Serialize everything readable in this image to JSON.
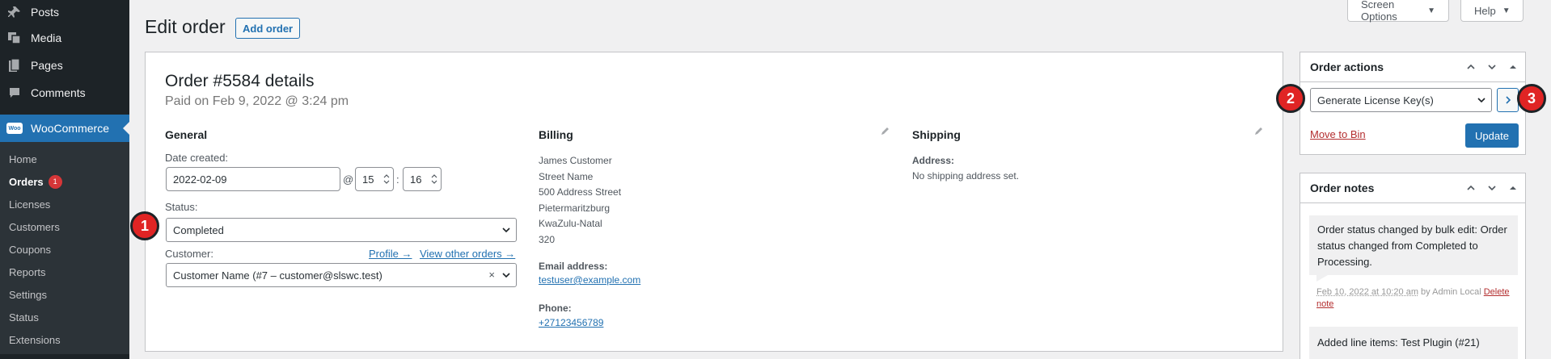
{
  "sidebar": {
    "items": [
      {
        "label": "Posts",
        "icon": "pin-icon"
      },
      {
        "label": "Media",
        "icon": "media-icon"
      },
      {
        "label": "Pages",
        "icon": "pages-icon"
      },
      {
        "label": "Comments",
        "icon": "comments-icon"
      }
    ],
    "woocommerce": {
      "label": "WooCommerce",
      "logo_text": "Woo"
    },
    "submenu": [
      {
        "label": "Home"
      },
      {
        "label": "Orders",
        "badge": "1"
      },
      {
        "label": "Licenses"
      },
      {
        "label": "Customers"
      },
      {
        "label": "Coupons"
      },
      {
        "label": "Reports"
      },
      {
        "label": "Settings"
      },
      {
        "label": "Status"
      },
      {
        "label": "Extensions"
      }
    ]
  },
  "top": {
    "screen_options": "Screen Options",
    "help": "Help"
  },
  "page": {
    "title": "Edit order",
    "add_order": "Add order"
  },
  "order": {
    "heading": "Order #5584 details",
    "paid": "Paid on Feb 9, 2022 @ 3:24 pm",
    "general": {
      "title": "General",
      "date_label": "Date created:",
      "date": "2022-02-09",
      "at": "@",
      "hour": "15",
      "colon": ":",
      "minute": "16",
      "status_label": "Status:",
      "status": "Completed",
      "customer_label": "Customer:",
      "profile_link": "Profile →",
      "view_orders_link": "View other orders →",
      "customer": "Customer Name (#7 – customer@slswc.test)",
      "clear": "×"
    },
    "billing": {
      "title": "Billing",
      "address_lines": [
        "James Customer",
        "Street Name",
        "500 Address Street",
        "Pietermaritzburg",
        "KwaZulu-Natal",
        "320"
      ],
      "email_label": "Email address:",
      "email": "testuser@example.com",
      "phone_label": "Phone:",
      "phone": "+27123456789"
    },
    "shipping": {
      "title": "Shipping",
      "address_label": "Address:",
      "no_address": "No shipping address set."
    }
  },
  "order_actions": {
    "title": "Order actions",
    "selected": "Generate License Key(s)",
    "move_to_bin": "Move to Bin",
    "update": "Update"
  },
  "order_notes": {
    "title": "Order notes",
    "notes": [
      {
        "text": "Order status changed by bulk edit: Order status changed from Completed to Processing.",
        "meta": "Feb 10, 2022 at 10:20 am",
        "by": "by Admin Local",
        "delete": "Delete note"
      },
      {
        "text": "Added line items: Test Plugin (#21)"
      }
    ]
  },
  "markers": [
    "1",
    "2",
    "3"
  ],
  "colors": {
    "accent": "#2271b1",
    "sidebar_bg": "#1d2327",
    "marker": "#e02424",
    "badge": "#d63638"
  }
}
